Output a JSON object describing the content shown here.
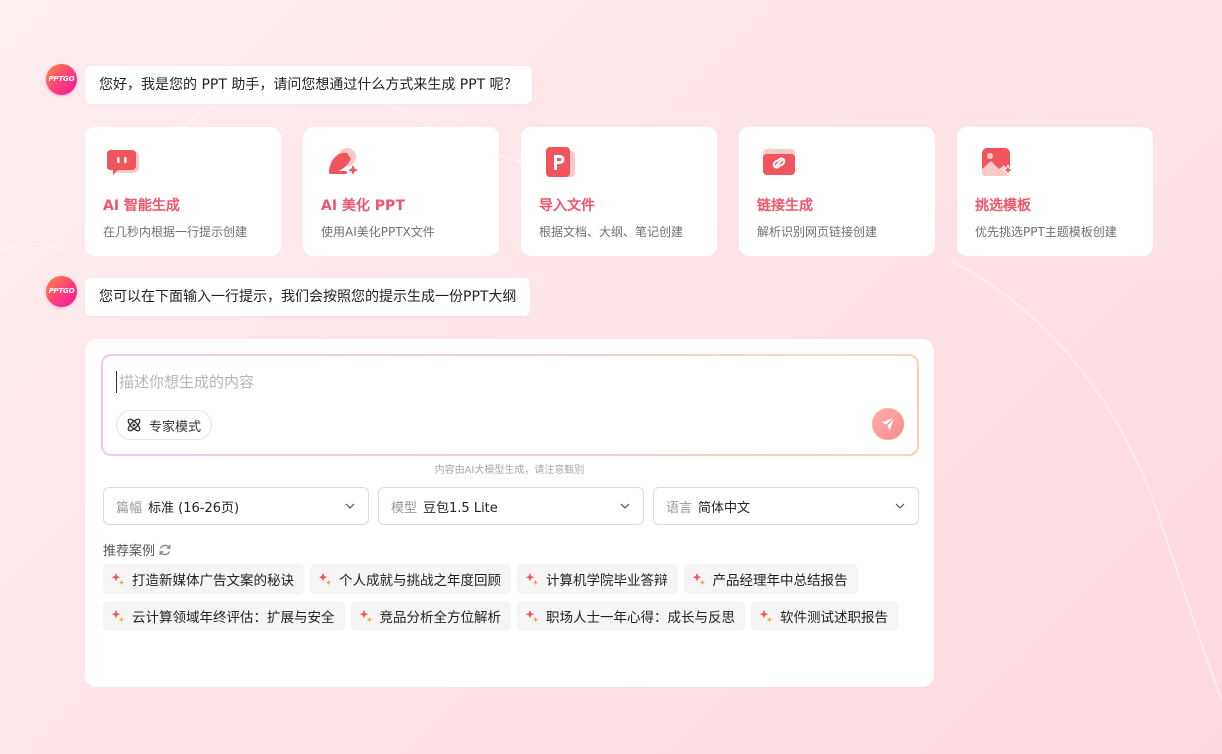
{
  "avatar_text": "PPTGO",
  "messages": {
    "greeting": "您好，我是您的 PPT 助手，请问您想通过什么方式来生成 PPT 呢？",
    "prompt_hint": "您可以在下面输入一行提示，我们会按照您的提示生成一份PPT大纲"
  },
  "cards": [
    {
      "title": "AI 智能生成",
      "desc": "在几秒内根据一行提示创建",
      "icon": "chat-bubble-icon"
    },
    {
      "title": "AI 美化 PPT",
      "desc": "使用AI美化PPTX文件",
      "icon": "brush-sparkle-icon"
    },
    {
      "title": "导入文件",
      "desc": "根据文档、大纲、笔记创建",
      "icon": "ppt-file-icon"
    },
    {
      "title": "链接生成",
      "desc": "解析识别网页链接创建",
      "icon": "link-icon"
    },
    {
      "title": "挑选模板",
      "desc": "优先挑选PPT主题模板创建",
      "icon": "image-sparkle-icon"
    }
  ],
  "prompt": {
    "placeholder": "描述你想生成的内容",
    "value": "",
    "expert_mode_label": "专家模式",
    "disclaimer": "内容由AI大模型生成，请注意甄别"
  },
  "selects": [
    {
      "label": "篇幅",
      "value": "标准 (16-26页)"
    },
    {
      "label": "模型",
      "value": "豆包1.5 Lite"
    },
    {
      "label": "语言",
      "value": "简体中文"
    }
  ],
  "recommend_title": "推荐案例",
  "recommendations": [
    "打造新媒体广告文案的秘诀",
    "个人成就与挑战之年度回顾",
    "计算机学院毕业答辩",
    "产品经理年中总结报告",
    "云计算领域年终评估：扩展与安全",
    "竞品分析全方位解析",
    "职场人士一年心得：成长与反思",
    "软件测试述职报告"
  ],
  "colors": {
    "accent": "#f0566b",
    "avatar_gradient": [
      "#ff8a3d",
      "#e8199a"
    ]
  }
}
